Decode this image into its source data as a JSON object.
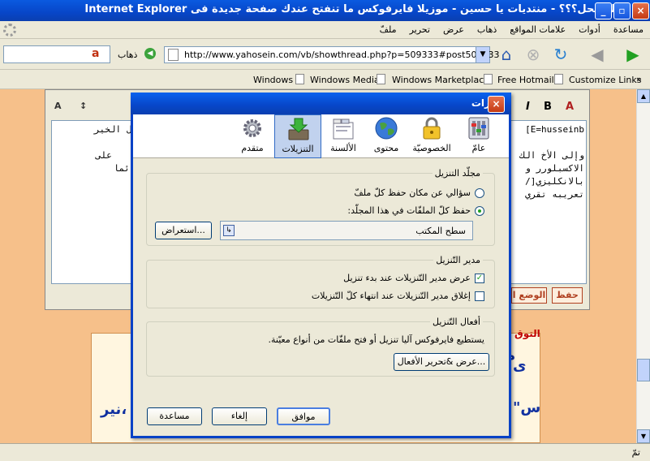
{
  "window": {
    "title": "اليك الحل؟؟؟ - منتديات يا حسين - موزيلا فايرفوكس ما تنفتح عندك صفحة جديدة فى Internet Explorer",
    "minimize": "_",
    "maximize": "▫",
    "close": "×"
  },
  "menu": {
    "items": [
      "ملفّ",
      "تحرير",
      "عرض",
      "ذهاب",
      "علامات المواقع",
      "أدوات",
      "مساعدة"
    ]
  },
  "nav": {
    "url": "http://www.yahosein.com/vb/showthread.php?p=509333#post509333",
    "go_label": "ذهاب",
    "search_glyph": "a"
  },
  "bookmarks": {
    "items": [
      "Windows",
      "Windows Media",
      "Windows Marketplace",
      "Free Hotmail",
      "Customize Links"
    ],
    "more": "»"
  },
  "editor": {
    "lines": [
      "E=husseinb]",
      "ل الخير",
      "وإلى الأخ الك",
      "على",
      "الاكسبلورر و",
      "ئما",
      "بالانكليزي[/",
      "تعريبه تقري"
    ],
    "save_label": "حفظ",
    "mode_label": "الوضع ا",
    "bold": "B",
    "italic": "I",
    "font_size_a": "A",
    "page_blue": [
      "ى",
      "م",
      "نير،",
      "\"س"
    ],
    "page_red": "التوق"
  },
  "dialog": {
    "title": "خيارات",
    "close": "×",
    "categories": [
      {
        "id": "main",
        "label": "عامّ",
        "icon": "switches-icon"
      },
      {
        "id": "privacy",
        "label": "الخصوصيّة",
        "icon": "lock-icon"
      },
      {
        "id": "content",
        "label": "محتوى",
        "icon": "globe-icon"
      },
      {
        "id": "tabs",
        "label": "الألسنة",
        "icon": "tabs-icon"
      },
      {
        "id": "downloads",
        "label": "التنزيلات",
        "icon": "download-icon"
      },
      {
        "id": "advanced",
        "label": "متقدم",
        "icon": "gear-icon"
      }
    ],
    "selected_category": "التنزيلات",
    "download_folder": {
      "title": "مجلّد التنزيل",
      "ask_option": "سؤالي عن مكان حفظ كلّ ملفّ",
      "save_option": "حفظ كلّ الملفّات في هذا المجلّد:",
      "folder_value": "سطح المكتب",
      "browse_button": "استعراض..."
    },
    "download_manager": {
      "title": "مدير التّنزيل",
      "show_option": "عرض مدير التّنزيلات عند بدء تنزيل",
      "show_checked": true,
      "close_option": "إغلاق مدير التّنزيلات عند انتهاء كلّ التّنزيلات",
      "close_checked": false
    },
    "download_actions": {
      "title": "أفعال التّنزيل",
      "description": "يستطيع فايرفوكس آليا تنزيل أو فتح ملفّات من أنواع معيّنة.",
      "edit_button": "عرض &تحرير الأفعال..."
    },
    "ok_button": "موافق",
    "cancel_button": "إلغاء",
    "help_button": "مساعدة"
  },
  "status": {
    "text": "تمّ"
  }
}
